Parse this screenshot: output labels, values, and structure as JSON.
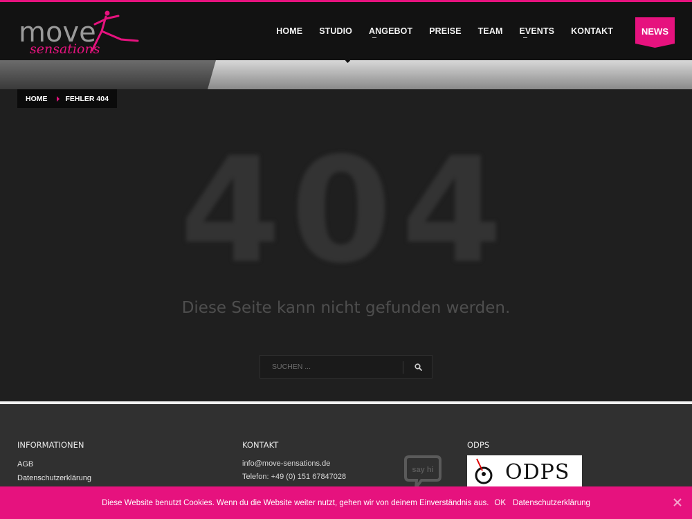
{
  "brand": {
    "logo_text_top": "move",
    "logo_text_bottom": "sensations",
    "accent": "#e6127e"
  },
  "nav": {
    "items": [
      {
        "label": "HOME",
        "has_sub": false
      },
      {
        "label": "STUDIO",
        "has_sub": false
      },
      {
        "label": "ANGEBOT",
        "has_sub": true
      },
      {
        "label": "PREISE",
        "has_sub": false
      },
      {
        "label": "TEAM",
        "has_sub": false
      },
      {
        "label": "EVENTS",
        "has_sub": true
      },
      {
        "label": "KONTAKT",
        "has_sub": false
      }
    ],
    "news_label": "NEWS"
  },
  "breadcrumb": {
    "home": "HOME",
    "current": "FEHLER 404"
  },
  "error": {
    "code": "404",
    "message": "Diese Seite kann nicht gefunden werden."
  },
  "search": {
    "placeholder": "SUCHEN ...",
    "icon": "search-icon"
  },
  "footer": {
    "informationen": {
      "heading": "INFORMATIONEN",
      "links": [
        "AGB",
        "Datenschutzerklärung"
      ]
    },
    "kontakt": {
      "heading": "KONTAKT",
      "email": "info@move-sensations.de",
      "phone": "Telefon: +49 (0) 151 67847028",
      "sayhi": "say hi"
    },
    "odps": {
      "heading": "ODPS",
      "logo_text": "ODPS"
    }
  },
  "cookie": {
    "text": "Diese Website benutzt Cookies. Wenn du die Website weiter nutzt, gehen wir von deinem Einverständnis aus.",
    "ok": "OK",
    "privacy": "Datenschutzerklärung"
  }
}
